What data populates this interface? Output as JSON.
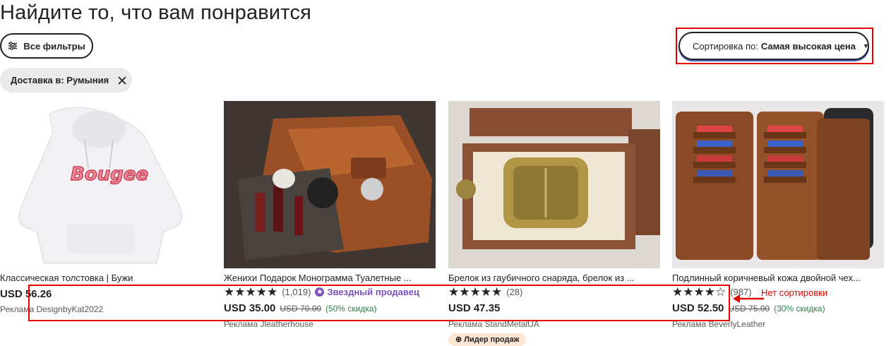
{
  "heading": "Найдите то, что вам понравится",
  "filters": {
    "label": "Все фильтры"
  },
  "chip": {
    "label": "Доставка в: Румыния"
  },
  "sort": {
    "prefix": "Сортировка по:",
    "value": "Самая высокая цена"
  },
  "annotation": {
    "text": "Нет сортировки"
  },
  "products": [
    {
      "title": "Классическая толстовка | Бужи",
      "price": "USD 56.26",
      "ad": "Реклама DesignbyKat2022"
    },
    {
      "title": "Женихи Подарок Монограмма Туалетные ...",
      "stars": "★★★★★",
      "reviews": "(1,019)",
      "star_seller": "Звездный продавец",
      "price": "USD 35.00",
      "old_price": "USD 70.00",
      "discount": "(50% скидка)",
      "ad": "Реклама Jleatherhouse"
    },
    {
      "title": "Брелок из гаубичного снаряда, брелок из ...",
      "stars": "★★★★★",
      "reviews": "(28)",
      "price": "USD 47.35",
      "ad": "Реклама StandMetalUA",
      "badge": "Лидер продаж"
    },
    {
      "title": "Подлинный коричневый кожа двойной чех...",
      "stars": "★★★★☆",
      "reviews": "(987)",
      "price": "USD 52.50",
      "old_price": "USD 75.00",
      "discount": "(30% скидка)",
      "ad": "Реклама BeverlyLeather"
    }
  ]
}
